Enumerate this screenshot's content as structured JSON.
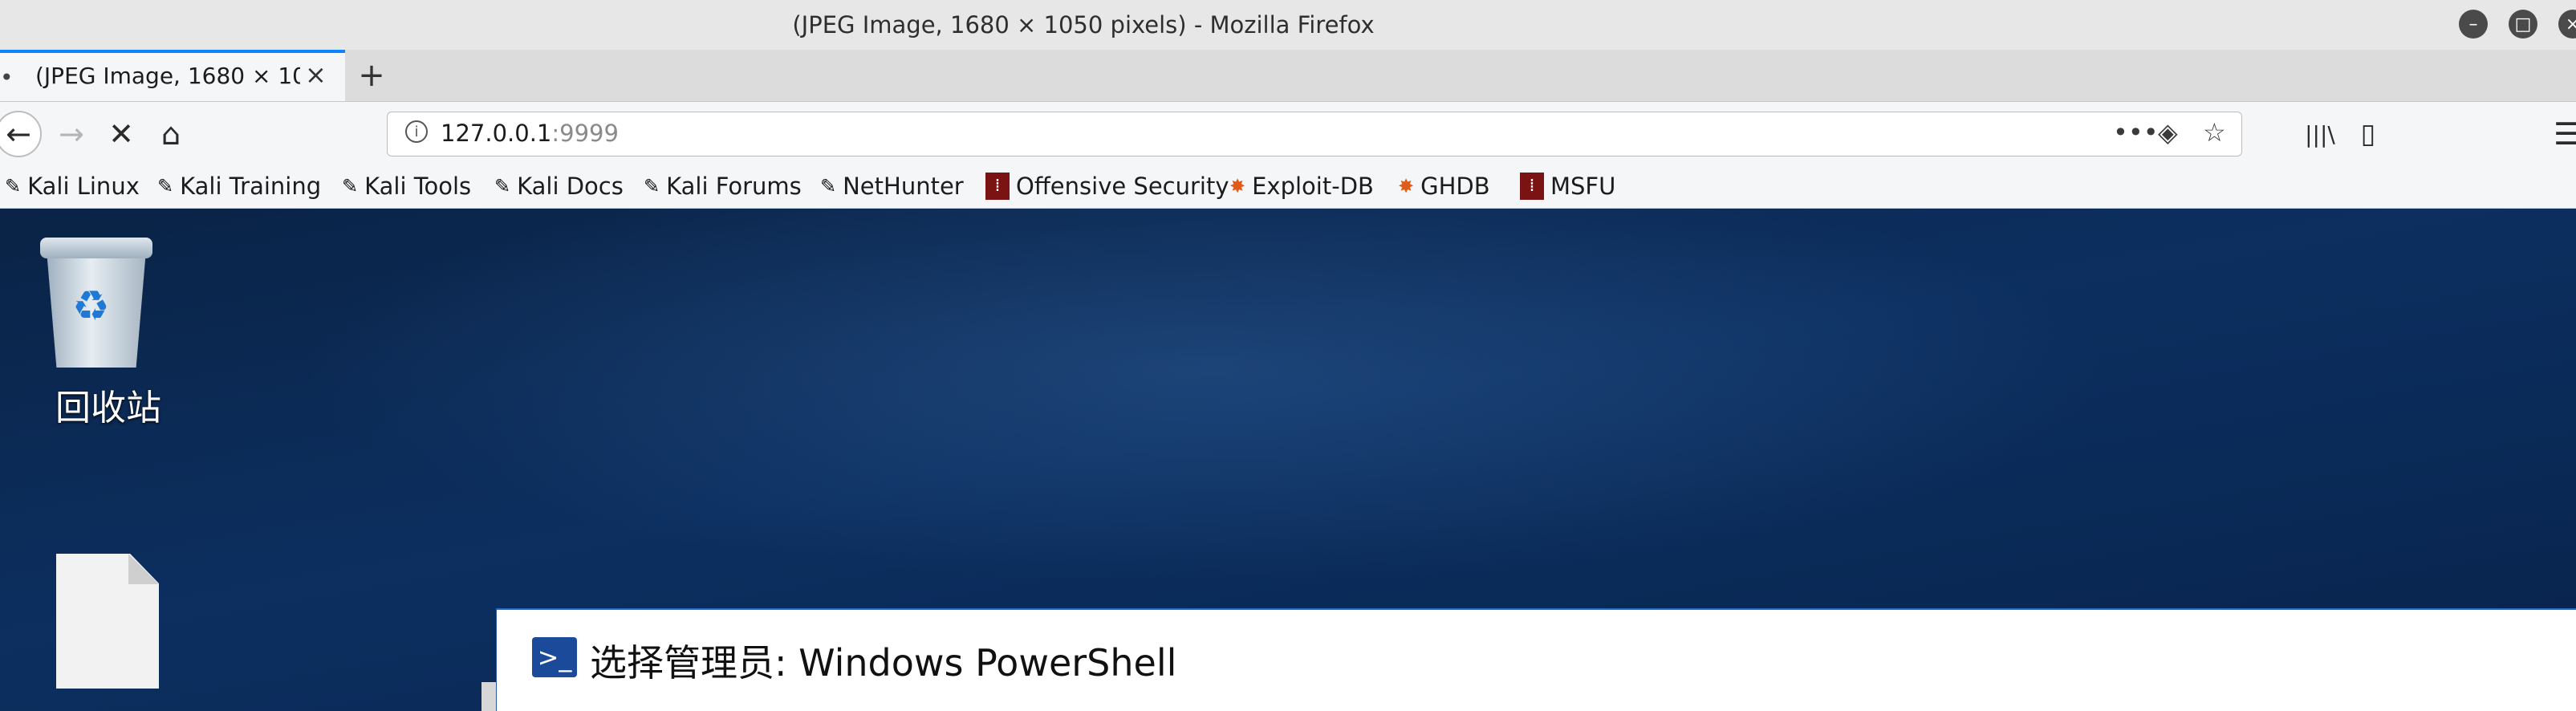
{
  "window": {
    "title": "(JPEG Image, 1680 × 1050 pixels) - Mozilla Firefox",
    "controls": [
      "minimize-icon",
      "maximize-icon",
      "close-icon"
    ]
  },
  "tabs": [
    {
      "title": "(JPEG Image, 1680 × 1050 pixels)",
      "active": true
    }
  ],
  "tab_ui": {
    "new_tab": "+",
    "close": "×",
    "dot": "•"
  },
  "nav": {
    "back": "←",
    "forward": "→",
    "stop": "✕",
    "home": "⌂",
    "url_host": "127.0.0.1",
    "url_port": ":9999",
    "page_actions": "•••",
    "pocket": "◈",
    "star": "☆",
    "library": "|||\\",
    "sidebar": "▯",
    "menu": "☰"
  },
  "bookmarks": [
    {
      "label": "Kali Linux",
      "icon": "kali-dragon-icon"
    },
    {
      "label": "Kali Training",
      "icon": "kali-dragon-icon"
    },
    {
      "label": "Kali Tools",
      "icon": "kali-dragon-icon"
    },
    {
      "label": "Kali Docs",
      "icon": "kali-dragon-icon"
    },
    {
      "label": "Kali Forums",
      "icon": "kali-dragon-icon"
    },
    {
      "label": "NetHunter",
      "icon": "kali-dragon-icon"
    },
    {
      "label": "Offensive Security",
      "icon": "offsec-icon"
    },
    {
      "label": "Exploit-DB",
      "icon": "exploitdb-icon"
    },
    {
      "label": "GHDB",
      "icon": "exploitdb-icon"
    },
    {
      "label": "MSFU",
      "icon": "offsec-icon"
    }
  ],
  "desktop": {
    "recycle_bin_label": "回收站",
    "file_icon": "document-icon"
  },
  "powershell": {
    "title": "选择管理员: Windows PowerShell",
    "icon": ">_"
  },
  "colors": {
    "accent": "#0a84ff",
    "desktop_bg": "#0b2a55",
    "powershell_icon": "#1b4a9a"
  }
}
